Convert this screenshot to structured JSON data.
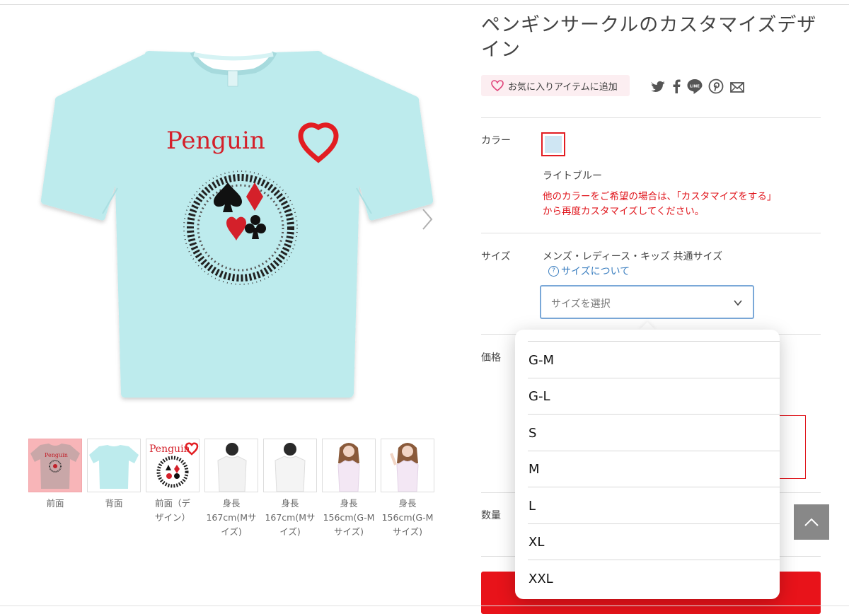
{
  "product": {
    "title": "ペンギンサークルのカスタマイズデザイン",
    "favorite_label": "お気に入りアイテムに追加",
    "print_text": "Penguin"
  },
  "share_icons": [
    "twitter-icon",
    "facebook-icon",
    "line-icon",
    "pinterest-icon",
    "mail-icon"
  ],
  "line_icon_text": "LINE",
  "color": {
    "label": "カラー",
    "value": "ライトブルー",
    "swatch": "#cfe6f3",
    "note_line1": "他のカラーをご希望の場合は、「カスタマイズをする」",
    "note_line2": "から再度カスタマイズしてください。"
  },
  "size": {
    "label": "サイズ",
    "type": "メンズ・レディース・キッズ 共通サイズ",
    "help_link": "サイズについて",
    "placeholder": "サイズを選択",
    "options": [
      "G-M",
      "G-L",
      "S",
      "M",
      "L",
      "XL",
      "XXL"
    ]
  },
  "price": {
    "label": "価格"
  },
  "quantity": {
    "label": "数量"
  },
  "thumbnails": [
    {
      "label": "前面"
    },
    {
      "label": "背面"
    },
    {
      "label": "前面（デザイン）"
    },
    {
      "label": "身長167cm(Mサイズ)"
    },
    {
      "label": "身長167cm(Mサイズ)"
    },
    {
      "label": "身長156cm(G-Mサイズ)"
    },
    {
      "label": "身長156cm(G-Mサイズ)"
    }
  ],
  "colors": {
    "accent_red": "#e0141b",
    "shirt": "#bdebed",
    "link_blue": "#3c7fc0"
  }
}
